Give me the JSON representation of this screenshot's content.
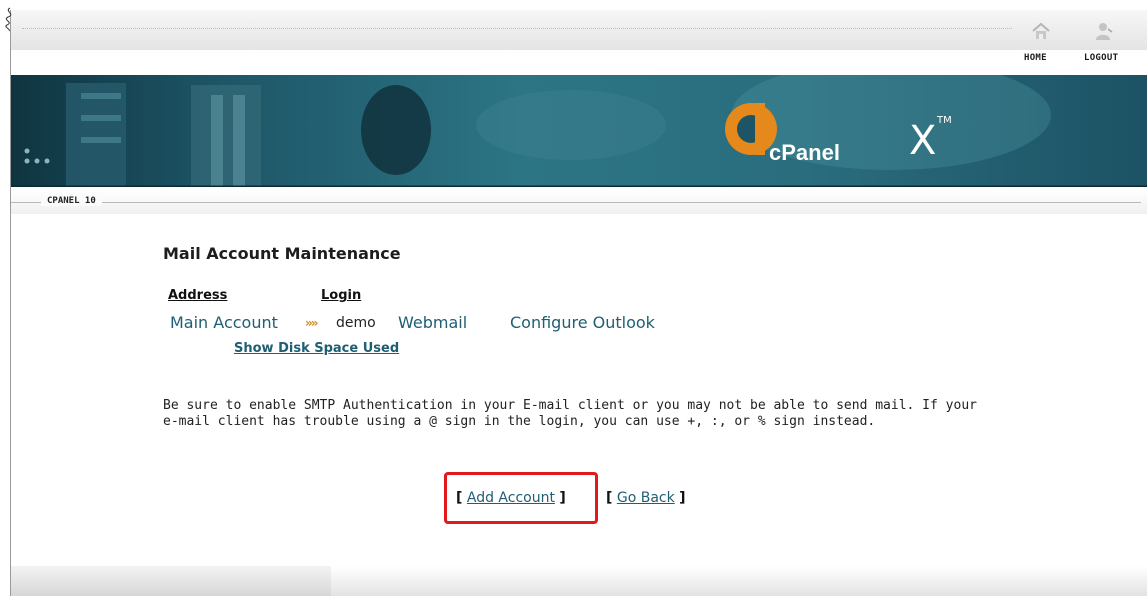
{
  "header": {
    "nav": [
      {
        "label": "HOME",
        "icon": "home-icon"
      },
      {
        "label": "LOGOUT",
        "icon": "logout-icon"
      }
    ]
  },
  "banner": {
    "logo_text": "cPanel",
    "logo_suffix": "X",
    "trademark": "TM"
  },
  "section": {
    "label": "CPANEL 10"
  },
  "main": {
    "title": "Mail Account Maintenance",
    "columns": {
      "address": "Address",
      "login": "Login"
    },
    "account": {
      "address": "Main Account",
      "separator": "»»",
      "login": "demo",
      "webmail": "Webmail",
      "configure": "Configure Outlook"
    },
    "disk_space_link": "Show Disk Space Used",
    "notice": "Be sure to enable SMTP Authentication in your E-mail client or you may not be able to send mail. If your e-mail client has trouble using a @ sign in the login, you can use +, :, or % sign instead.",
    "actions": {
      "bracket_open": "[",
      "bracket_close": "]",
      "add_account": "Add Account",
      "go_back": "Go Back"
    }
  },
  "colors": {
    "link": "#1f5e73",
    "highlight": "#e0191b",
    "separator_arrows": "#d28b1e"
  }
}
